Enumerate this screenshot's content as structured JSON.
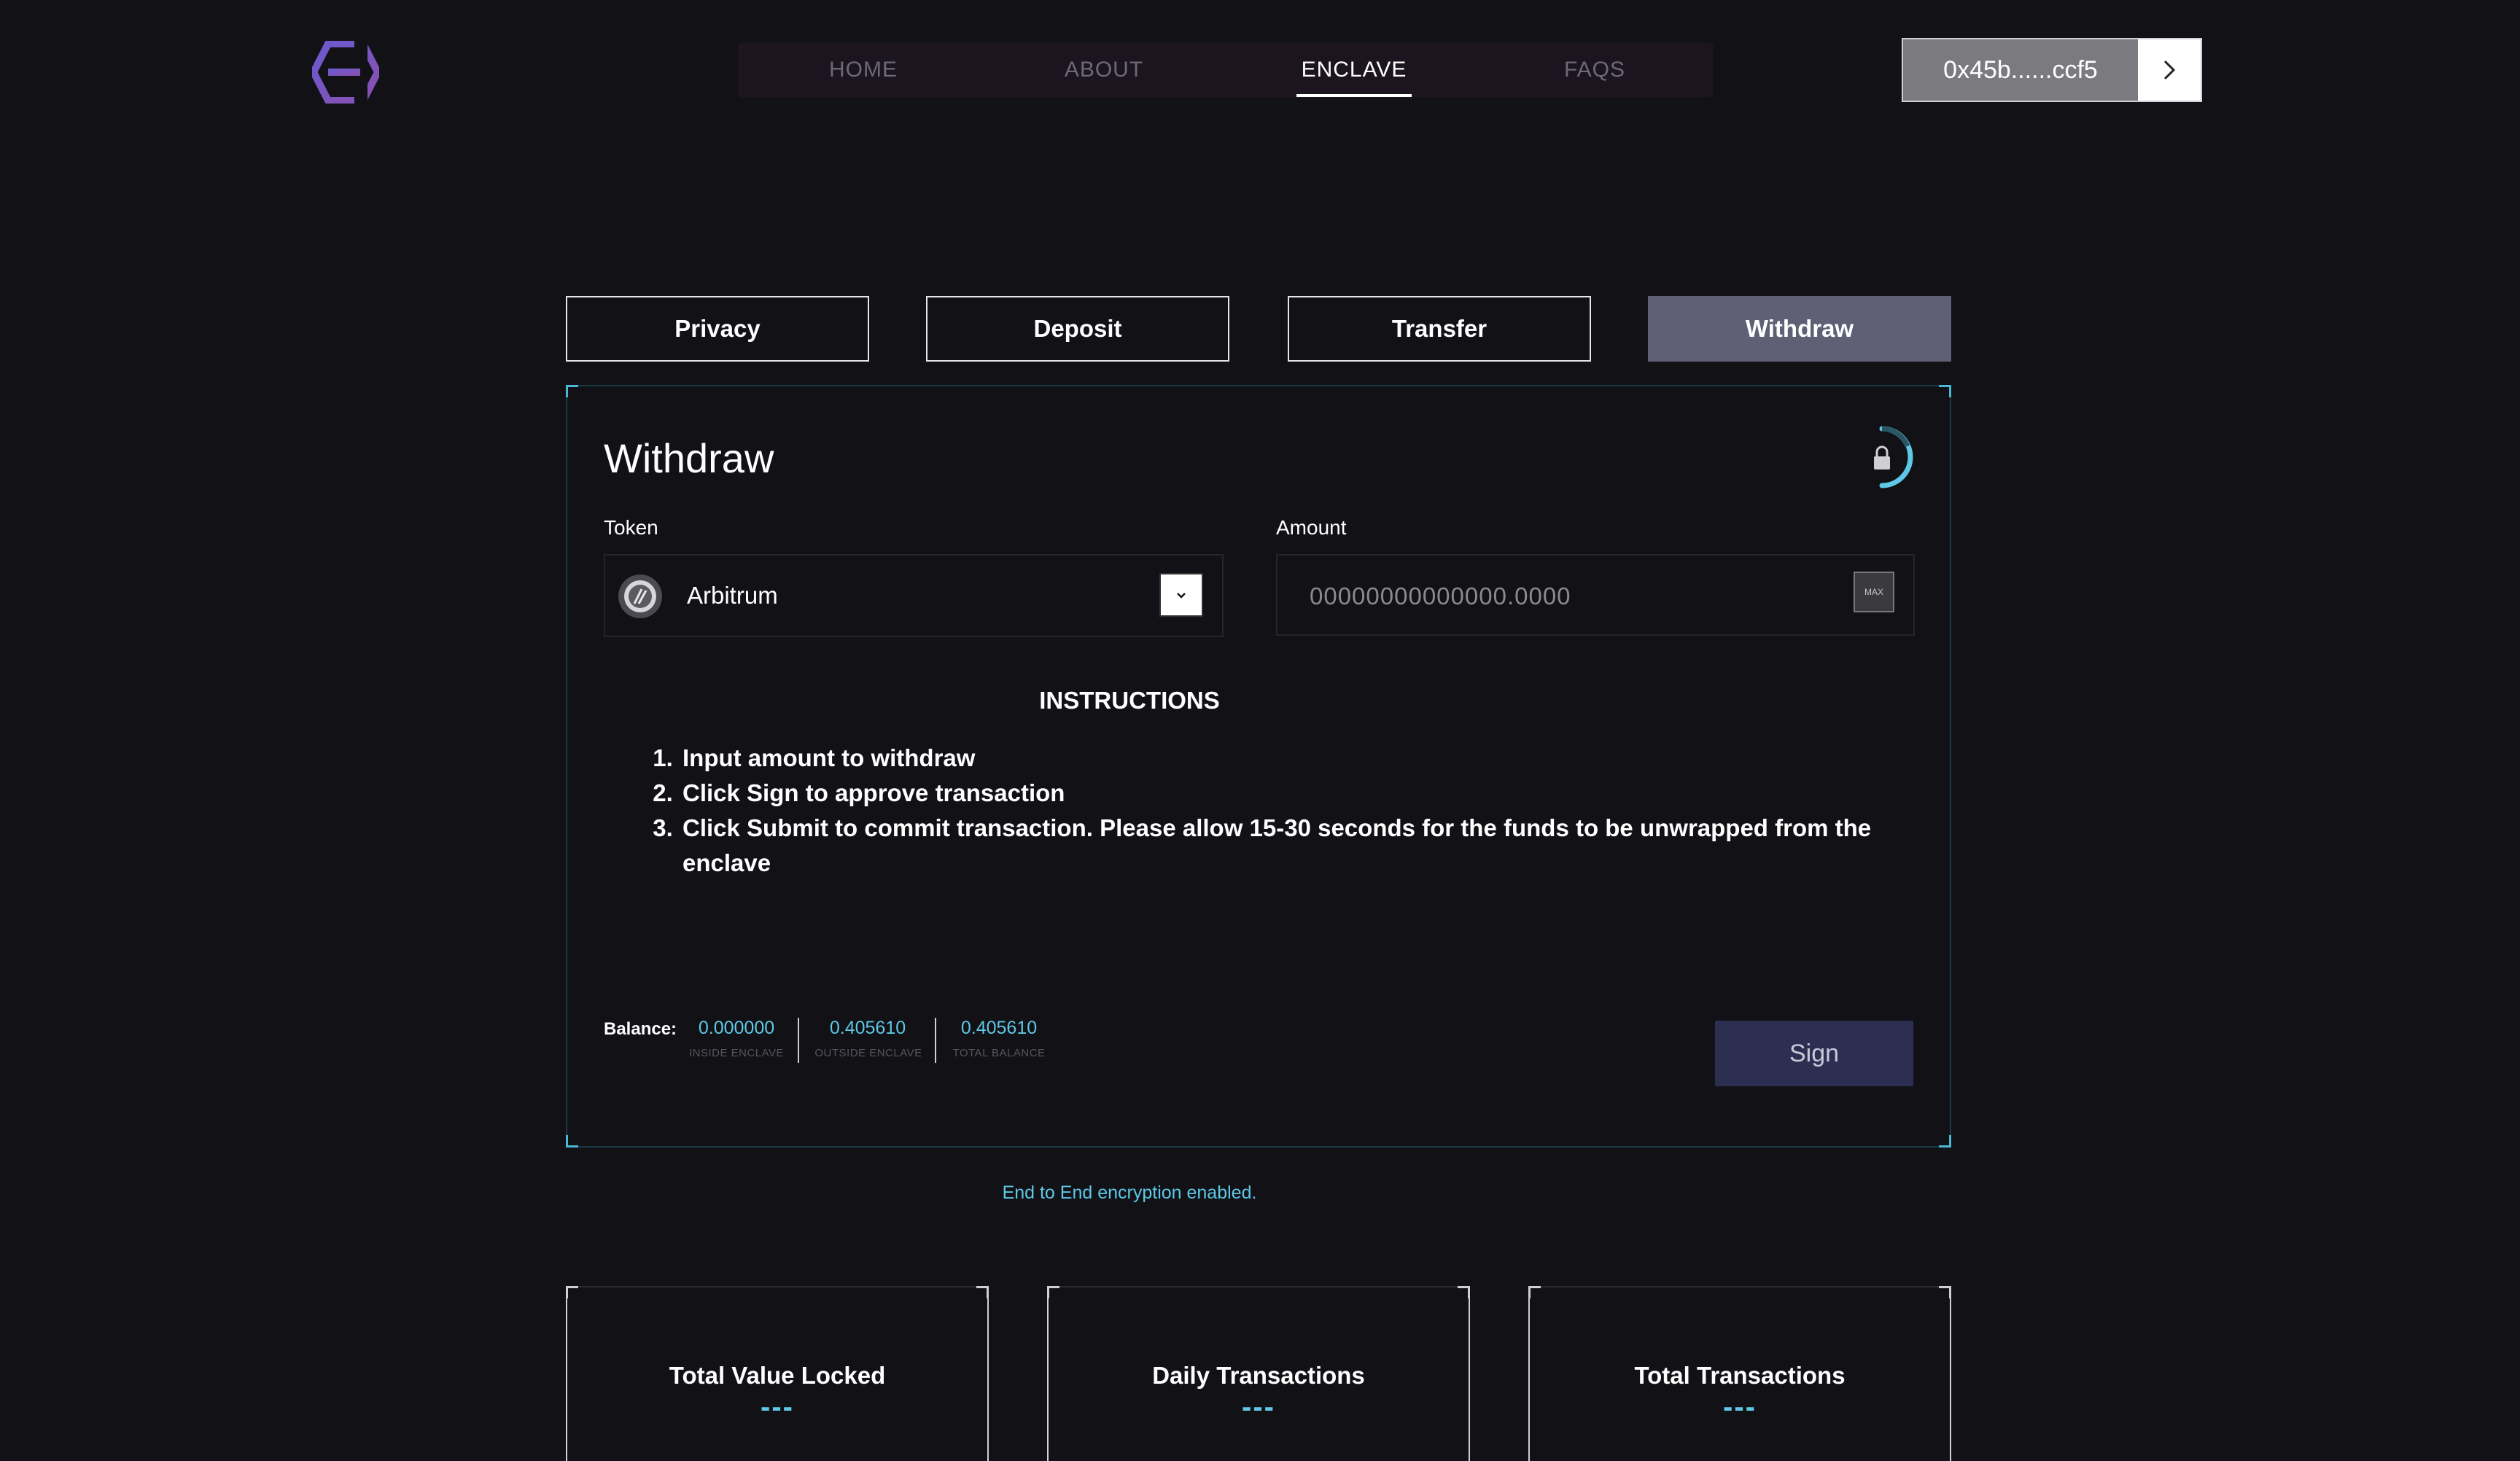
{
  "nav": {
    "items": [
      {
        "label": "HOME",
        "active": false
      },
      {
        "label": "ABOUT",
        "active": false
      },
      {
        "label": "ENCLAVE",
        "active": true
      },
      {
        "label": "FAQS",
        "active": false
      }
    ]
  },
  "wallet": {
    "address": "0x45b......ccf5",
    "icon": "chevron-right-icon"
  },
  "tabs": [
    {
      "label": "Privacy",
      "active": false
    },
    {
      "label": "Deposit",
      "active": false
    },
    {
      "label": "Transfer",
      "active": false
    },
    {
      "label": "Withdraw",
      "active": true
    }
  ],
  "panel": {
    "title": "Withdraw",
    "token_label": "Token",
    "token_selected": "Arbitrum",
    "amount_label": "Amount",
    "amount_placeholder": "00000000000000.0000",
    "max_label": "MAX",
    "instructions_title": "INSTRUCTIONS",
    "instructions": [
      "Input amount to withdraw",
      "Click Sign to approve transaction",
      "Click Submit to commit transaction. Please allow 15-30 seconds for the funds to be unwrapped from the enclave"
    ],
    "balance": {
      "label": "Balance:",
      "inside": {
        "value": "0.000000",
        "caption": "INSIDE ENCLAVE"
      },
      "outside": {
        "value": "0.405610",
        "caption": "OUTSIDE ENCLAVE"
      },
      "total": {
        "value": "0.405610",
        "caption": "TOTAL BALANCE"
      }
    },
    "sign_label": "Sign"
  },
  "footer_note": "End to End encryption enabled.",
  "stats": [
    {
      "title": "Total Value Locked",
      "value": "---"
    },
    {
      "title": "Daily Transactions",
      "value": "---"
    },
    {
      "title": "Total Transactions",
      "value": "---"
    }
  ],
  "colors": {
    "accent": "#5ec8e6",
    "active_tab": "#5f5f76",
    "sign_button": "#2c2f52",
    "background": "#111116"
  }
}
